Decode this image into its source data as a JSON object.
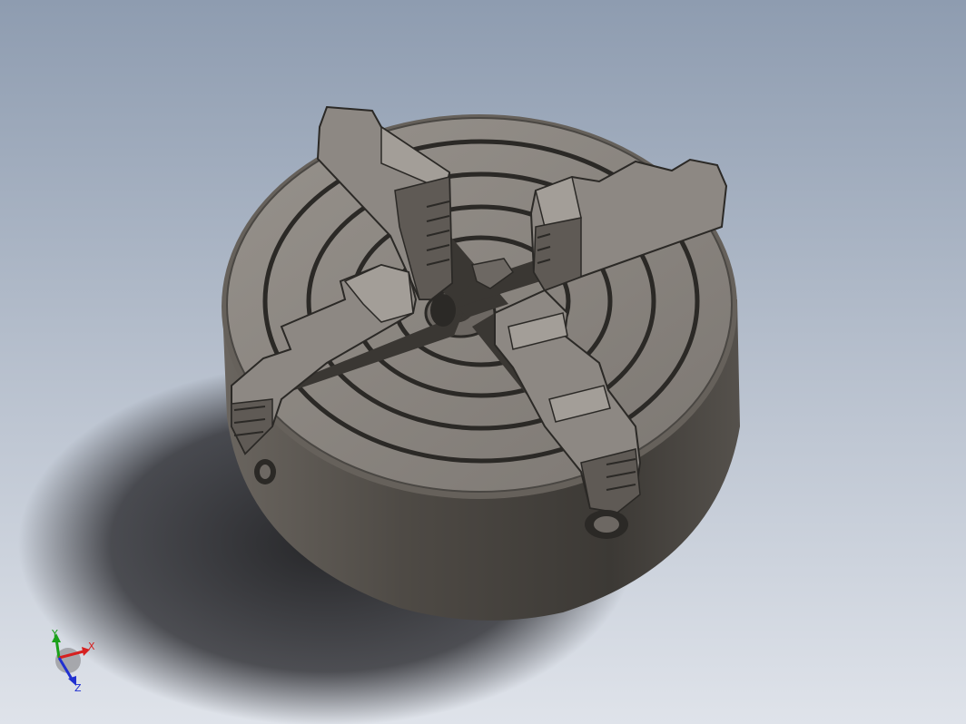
{
  "viewport": {
    "background_top": "#8e9cb0",
    "background_bottom": "#dfe3ea"
  },
  "model": {
    "body_color": "#5b5650",
    "face_color": "#8a8580",
    "jaw_color": "#8d8883",
    "groove_color": "#2b2926"
  },
  "triad": {
    "x_label": "X",
    "y_label": "Y",
    "z_label": "Z",
    "x_color": "#d62020",
    "y_color": "#1aa01a",
    "z_color": "#2030d0"
  }
}
